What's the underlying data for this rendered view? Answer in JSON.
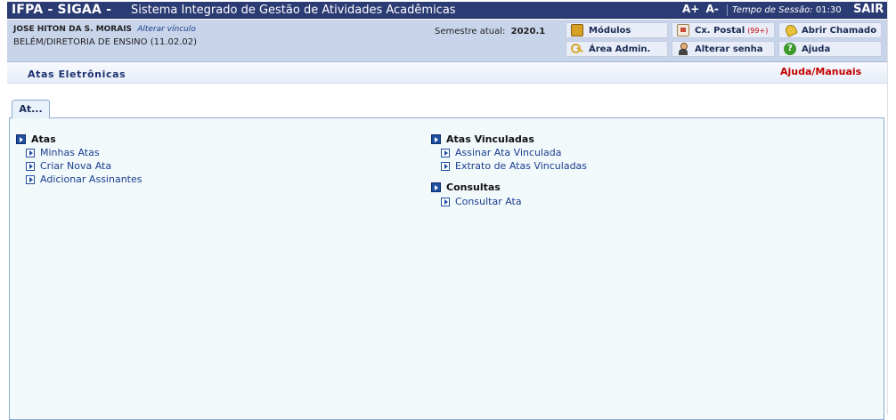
{
  "header": {
    "brand": "IFPA - SIGAA -",
    "subtitle": "Sistema Integrado de Gestão de Atividades Acadêmicas",
    "font_increase": "A+",
    "font_decrease": "A-",
    "session_label": "Tempo de Sessão:",
    "session_time": "01:30",
    "logout": "SAIR"
  },
  "user": {
    "name": "JOSE HITON DA S. MORAIS",
    "change_link": "Alterar vínculo",
    "unit": "BELÉM/DIRETORIA DE ENSINO (11.02.02)",
    "semester_label": "Semestre atual:",
    "semester_value": "2020.1"
  },
  "quick_buttons": {
    "modulos": "Módulos",
    "caixa_postal": "Cx. Postal",
    "caixa_postal_badge": "(99+)",
    "abrir_chamado": "Abrir Chamado",
    "area_admin": "Área Admin.",
    "alterar_senha": "Alterar senha",
    "ajuda": "Ajuda"
  },
  "page": {
    "title": "Atas Eletrônicas",
    "help_link": "Ajuda/Manuais",
    "tab_label": "At..."
  },
  "sections": {
    "atas": {
      "title": "Atas",
      "items": [
        "Minhas Atas",
        "Criar Nova Ata",
        "Adicionar Assinantes"
      ]
    },
    "vinculadas": {
      "title": "Atas Vinculadas",
      "items": [
        "Assinar Ata Vinculada",
        "Extrato de Atas Vinculadas"
      ]
    },
    "consultas": {
      "title": "Consultas",
      "items": [
        "Consultar Ata"
      ]
    }
  },
  "colors": {
    "top_bar": "#2b3b73",
    "info_bar": "#c8d4ea",
    "panel": "#f2f9fb",
    "link": "#1a3d8f",
    "help": "#c40000"
  }
}
